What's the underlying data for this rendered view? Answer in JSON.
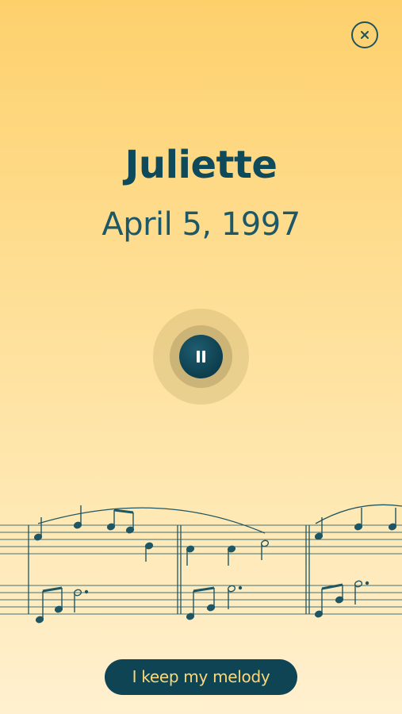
{
  "header": {
    "close_icon": "close-icon"
  },
  "profile": {
    "name": "Juliette",
    "birth_date": "April 5, 1997"
  },
  "player": {
    "state": "playing",
    "control_icon": "pause-icon"
  },
  "music": {
    "decoration": "sheet-music-staff"
  },
  "cta": {
    "label": "I keep my melody"
  },
  "colors": {
    "primary": "#0e4454",
    "text": "#0f4a5a",
    "cta_text": "#fdd876",
    "background_top": "#fdd06c",
    "background_bottom": "#fff0cf"
  }
}
